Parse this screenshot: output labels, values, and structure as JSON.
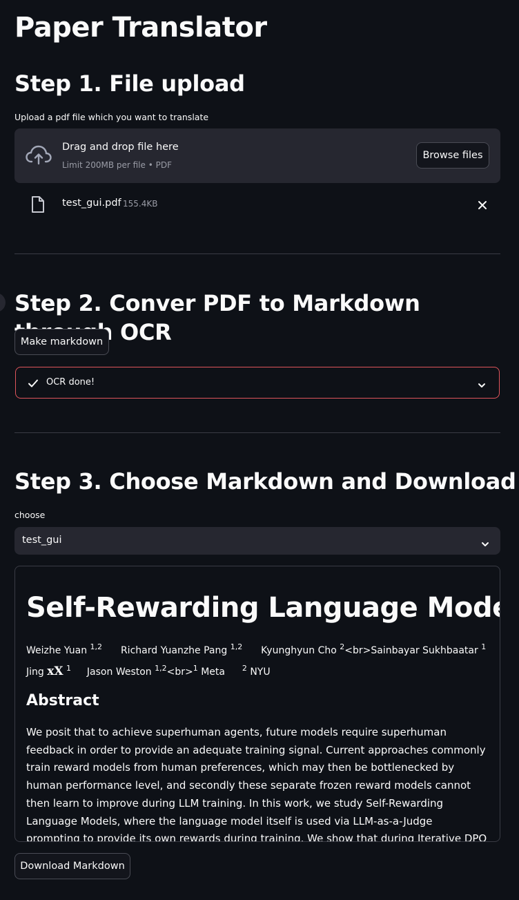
{
  "app": {
    "title": "Paper Translator"
  },
  "step1": {
    "heading": "Step 1. File upload",
    "label": "Upload a pdf file which you want to translate",
    "dropzone_title": "Drag and drop file here",
    "dropzone_hint": "Limit 200MB per file • PDF",
    "browse_label": "Browse files",
    "file_name": "test_gui.pdf",
    "file_size": "155.4KB"
  },
  "step2": {
    "heading": "Step 2. Conver PDF to Markdown through OCR",
    "button_label": "Make markdown",
    "status_text": "OCR done!"
  },
  "step3": {
    "heading": "Step 3. Choose Markdown and Download",
    "select_label": "choose",
    "select_value": "test_gui",
    "download_label": "Download Markdown"
  },
  "markdown": {
    "title": "Self-Rewarding Language Models",
    "authors_line1": {
      "a1": "Weizhe Yuan",
      "a1_sup": "1,2",
      "a2": "Richard Yuanzhe Pang",
      "a2_sup": "1,2",
      "a3": "Kyunghyun Cho",
      "a3_sup": "2",
      "a4": "<br>Sainbayar Sukhbaatar",
      "a4_sup": "1"
    },
    "authors_line2": {
      "a5": "Jing",
      "a5_math": "xX",
      "a5_sup": "1",
      "a6": "Jason Weston",
      "a6_sup": "1,2",
      "a6_tail": "<br>",
      "aff1_sup": "1",
      "aff1": "Meta",
      "aff2_sup": "2",
      "aff2": "NYU"
    },
    "abstract_heading": "Abstract",
    "abstract_text": "We posit that to achieve superhuman agents, future models require superhuman feedback in order to provide an adequate training signal. Current approaches commonly train reward models from human preferences, which may then be bottlenecked by human performance level, and secondly these separate frozen reward models cannot then learn to improve during LLM training. In this work, we study Self-Rewarding Language Models, where the language model itself is used via LLM-as-a-Judge prompting to provide its own rewards during training. We show that during Iterative DPO training that not only does instruction following ability improve, but also the ability to provide high-"
  },
  "icons": {
    "upload": "cloud-upload-icon",
    "file": "file-icon",
    "close": "close-icon",
    "check": "check-icon",
    "chevron": "chevron-down-icon"
  }
}
